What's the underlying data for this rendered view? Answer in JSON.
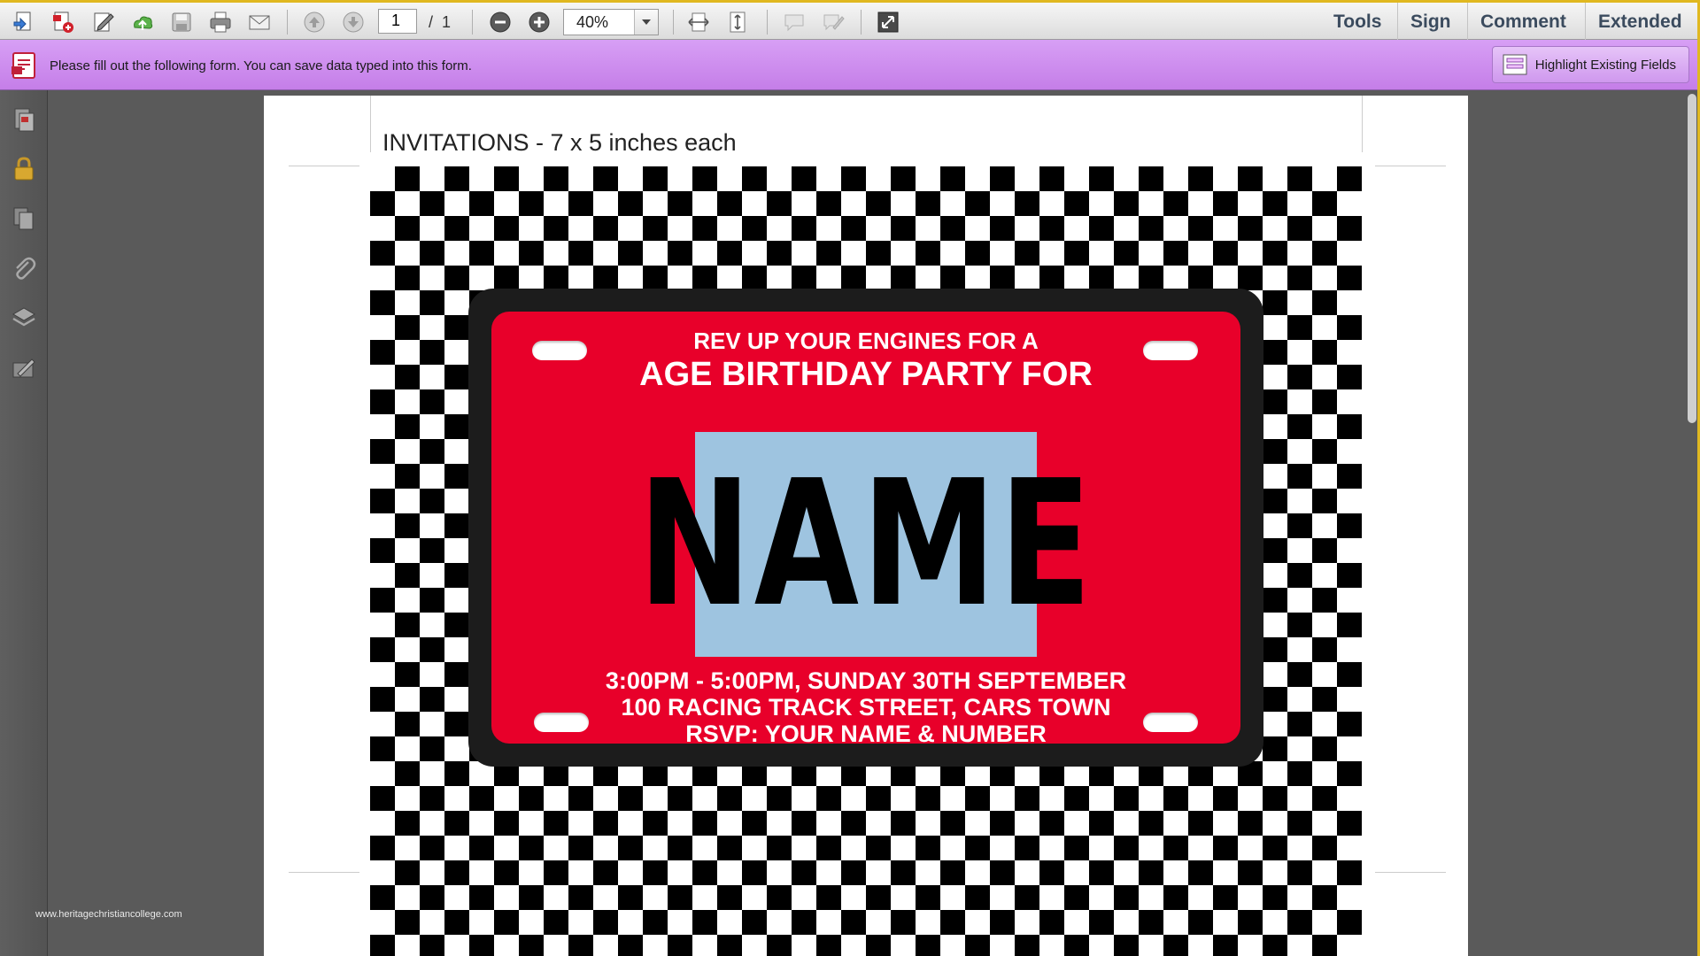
{
  "toolbar": {
    "page_current": "1",
    "page_total": "/  1",
    "zoom": "40%",
    "pane_buttons": [
      "Tools",
      "Sign",
      "Comment",
      "Extended"
    ]
  },
  "form_bar": {
    "message": "Please fill out the following form. You can save data typed into this form.",
    "highlight_button": "Highlight Existing Fields"
  },
  "document": {
    "title": "INVITATIONS - 7 x 5 inches each",
    "invitation": {
      "line1": "REV UP YOUR ENGINES FOR A",
      "line2": "AGE BIRTHDAY PARTY FOR",
      "name_field": "NAME",
      "time": "3:00PM - 5:00PM, SUNDAY 30TH SEPTEMBER",
      "address": "100 RACING TRACK STREET, CARS TOWN",
      "rsvp": "RSVP: YOUR NAME & NUMBER"
    }
  },
  "watermark": "www.heritagechristiancollege.com",
  "colors": {
    "plate_red": "#e8002a",
    "name_field_blue": "#9ec4e0",
    "form_bar_purple": "#c98af0",
    "accent_gold": "#e0b820"
  },
  "icons": {
    "toolbar": [
      "create-icon",
      "pdf-add-icon",
      "edit-icon",
      "upload-icon",
      "save-icon",
      "print-icon",
      "email-icon",
      "page-up-icon",
      "page-down-icon",
      "zoom-out-icon",
      "zoom-in-icon",
      "fit-width-icon",
      "fit-page-icon",
      "comment-icon",
      "markup-icon",
      "fullscreen-icon"
    ],
    "left_nav": [
      "pages-icon",
      "lock-icon",
      "copy-icon",
      "attachment-icon",
      "layers-icon",
      "signature-icon"
    ]
  }
}
